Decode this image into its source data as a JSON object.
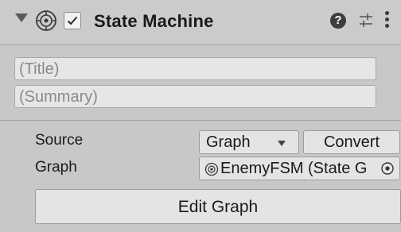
{
  "header": {
    "title": "State Machine",
    "help_glyph": "?",
    "enabled": true
  },
  "fields": {
    "title_placeholder": "(Title)",
    "summary_placeholder": "(Summary)"
  },
  "properties": {
    "source_label": "Source",
    "source_value": "Graph",
    "convert_label": "Convert",
    "graph_label": "Graph",
    "graph_value": "EnemyFSM (State G"
  },
  "actions": {
    "edit_graph_label": "Edit Graph"
  },
  "icons": [
    "foldout-arrow-icon",
    "state-machine-icon",
    "checkbox-check-icon",
    "help-icon",
    "preset-icon",
    "context-menu-icon",
    "object-picker-icon"
  ]
}
